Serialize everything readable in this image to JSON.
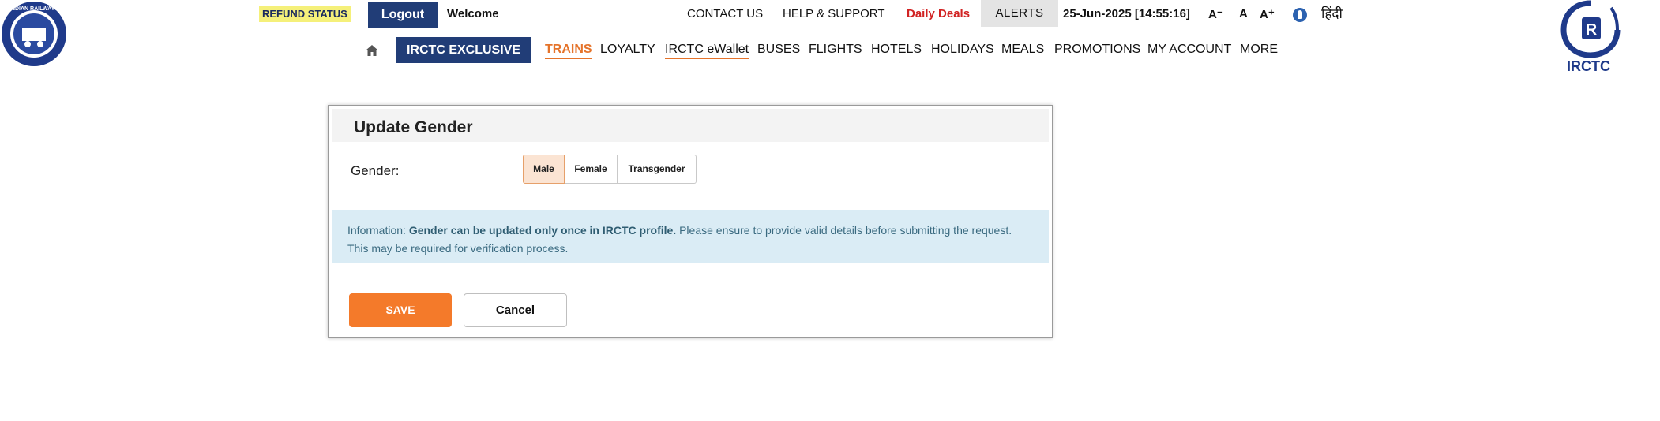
{
  "logos": {
    "left_alt": "INDIAN RAILWAYS",
    "right_text": "IRCTC"
  },
  "topbar": {
    "refund_status": "REFUND STATUS",
    "logout": "Logout",
    "welcome": "Welcome",
    "contact_us": "CONTACT US",
    "help_support": "HELP & SUPPORT",
    "daily_deals": "Daily Deals",
    "alerts": "ALERTS",
    "datetime": "25-Jun-2025 [14:55:16]",
    "font_decrease": "A⁻",
    "font_normal": "A",
    "font_increase": "A⁺",
    "hindi": "हिंदी"
  },
  "nav": {
    "exclusive": "IRCTC EXCLUSIVE",
    "items": [
      "TRAINS",
      "LOYALTY",
      "IRCTC eWallet",
      "BUSES",
      "FLIGHTS",
      "HOTELS",
      "HOLIDAYS",
      "MEALS",
      "PROMOTIONS",
      "MY ACCOUNT",
      "MORE"
    ]
  },
  "dialog": {
    "title": "Update Gender",
    "gender_label": "Gender:",
    "options": [
      "Male",
      "Female",
      "Transgender"
    ],
    "selected": "Male",
    "info_prefix": "Information: ",
    "info_bold": "Gender can be updated only once in IRCTC profile.",
    "info_rest": " Please ensure to provide valid details before submitting the request. This may be required for verification process.",
    "save": "SAVE",
    "cancel": "Cancel"
  },
  "colors": {
    "brand_navy": "#213d77",
    "accent_orange": "#f47a2a",
    "deals_red": "#d12323",
    "info_bg": "#daecf5"
  }
}
